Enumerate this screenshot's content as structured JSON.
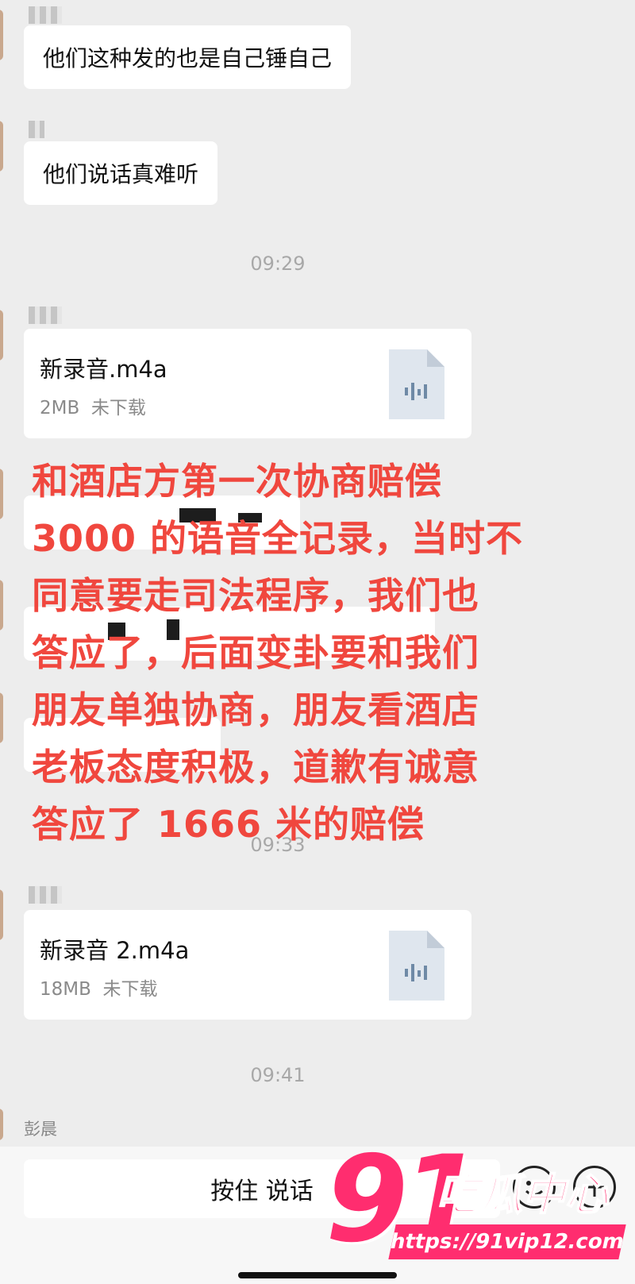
{
  "messages": [
    {
      "type": "text",
      "text": "他们这种发的也是自己锤自己"
    },
    {
      "type": "text",
      "text": "他们说话真难听"
    },
    {
      "type": "time",
      "text": "09:29"
    },
    {
      "type": "file",
      "name": "新录音.m4a",
      "size": "2MB",
      "status": "未下载"
    },
    {
      "type": "time",
      "text": "09:33"
    },
    {
      "type": "file",
      "name": "新录音 2.m4a",
      "size": "18MB",
      "status": "未下载"
    },
    {
      "type": "time",
      "text": "09:41"
    }
  ],
  "last_sender": "彭晨",
  "overlay_lines": [
    "和酒店方第一次协商赔偿",
    "3000 的语音全记录，当时不",
    "同意要走司法程序，我们也",
    "答应了，后面变卦要和我们",
    "朋友单独协商，朋友看酒店",
    "老板态度积极，道歉有诚意",
    "答应了 1666 米的赔偿"
  ],
  "input_bar": {
    "talk_label": "按住 说话"
  },
  "watermark": {
    "number": "91",
    "name": "吃瓜中心",
    "url": "https://91vip12.com"
  },
  "colors": {
    "overlay": "#f0473e",
    "watermark": "#ff2d6f",
    "background": "#ededed"
  }
}
